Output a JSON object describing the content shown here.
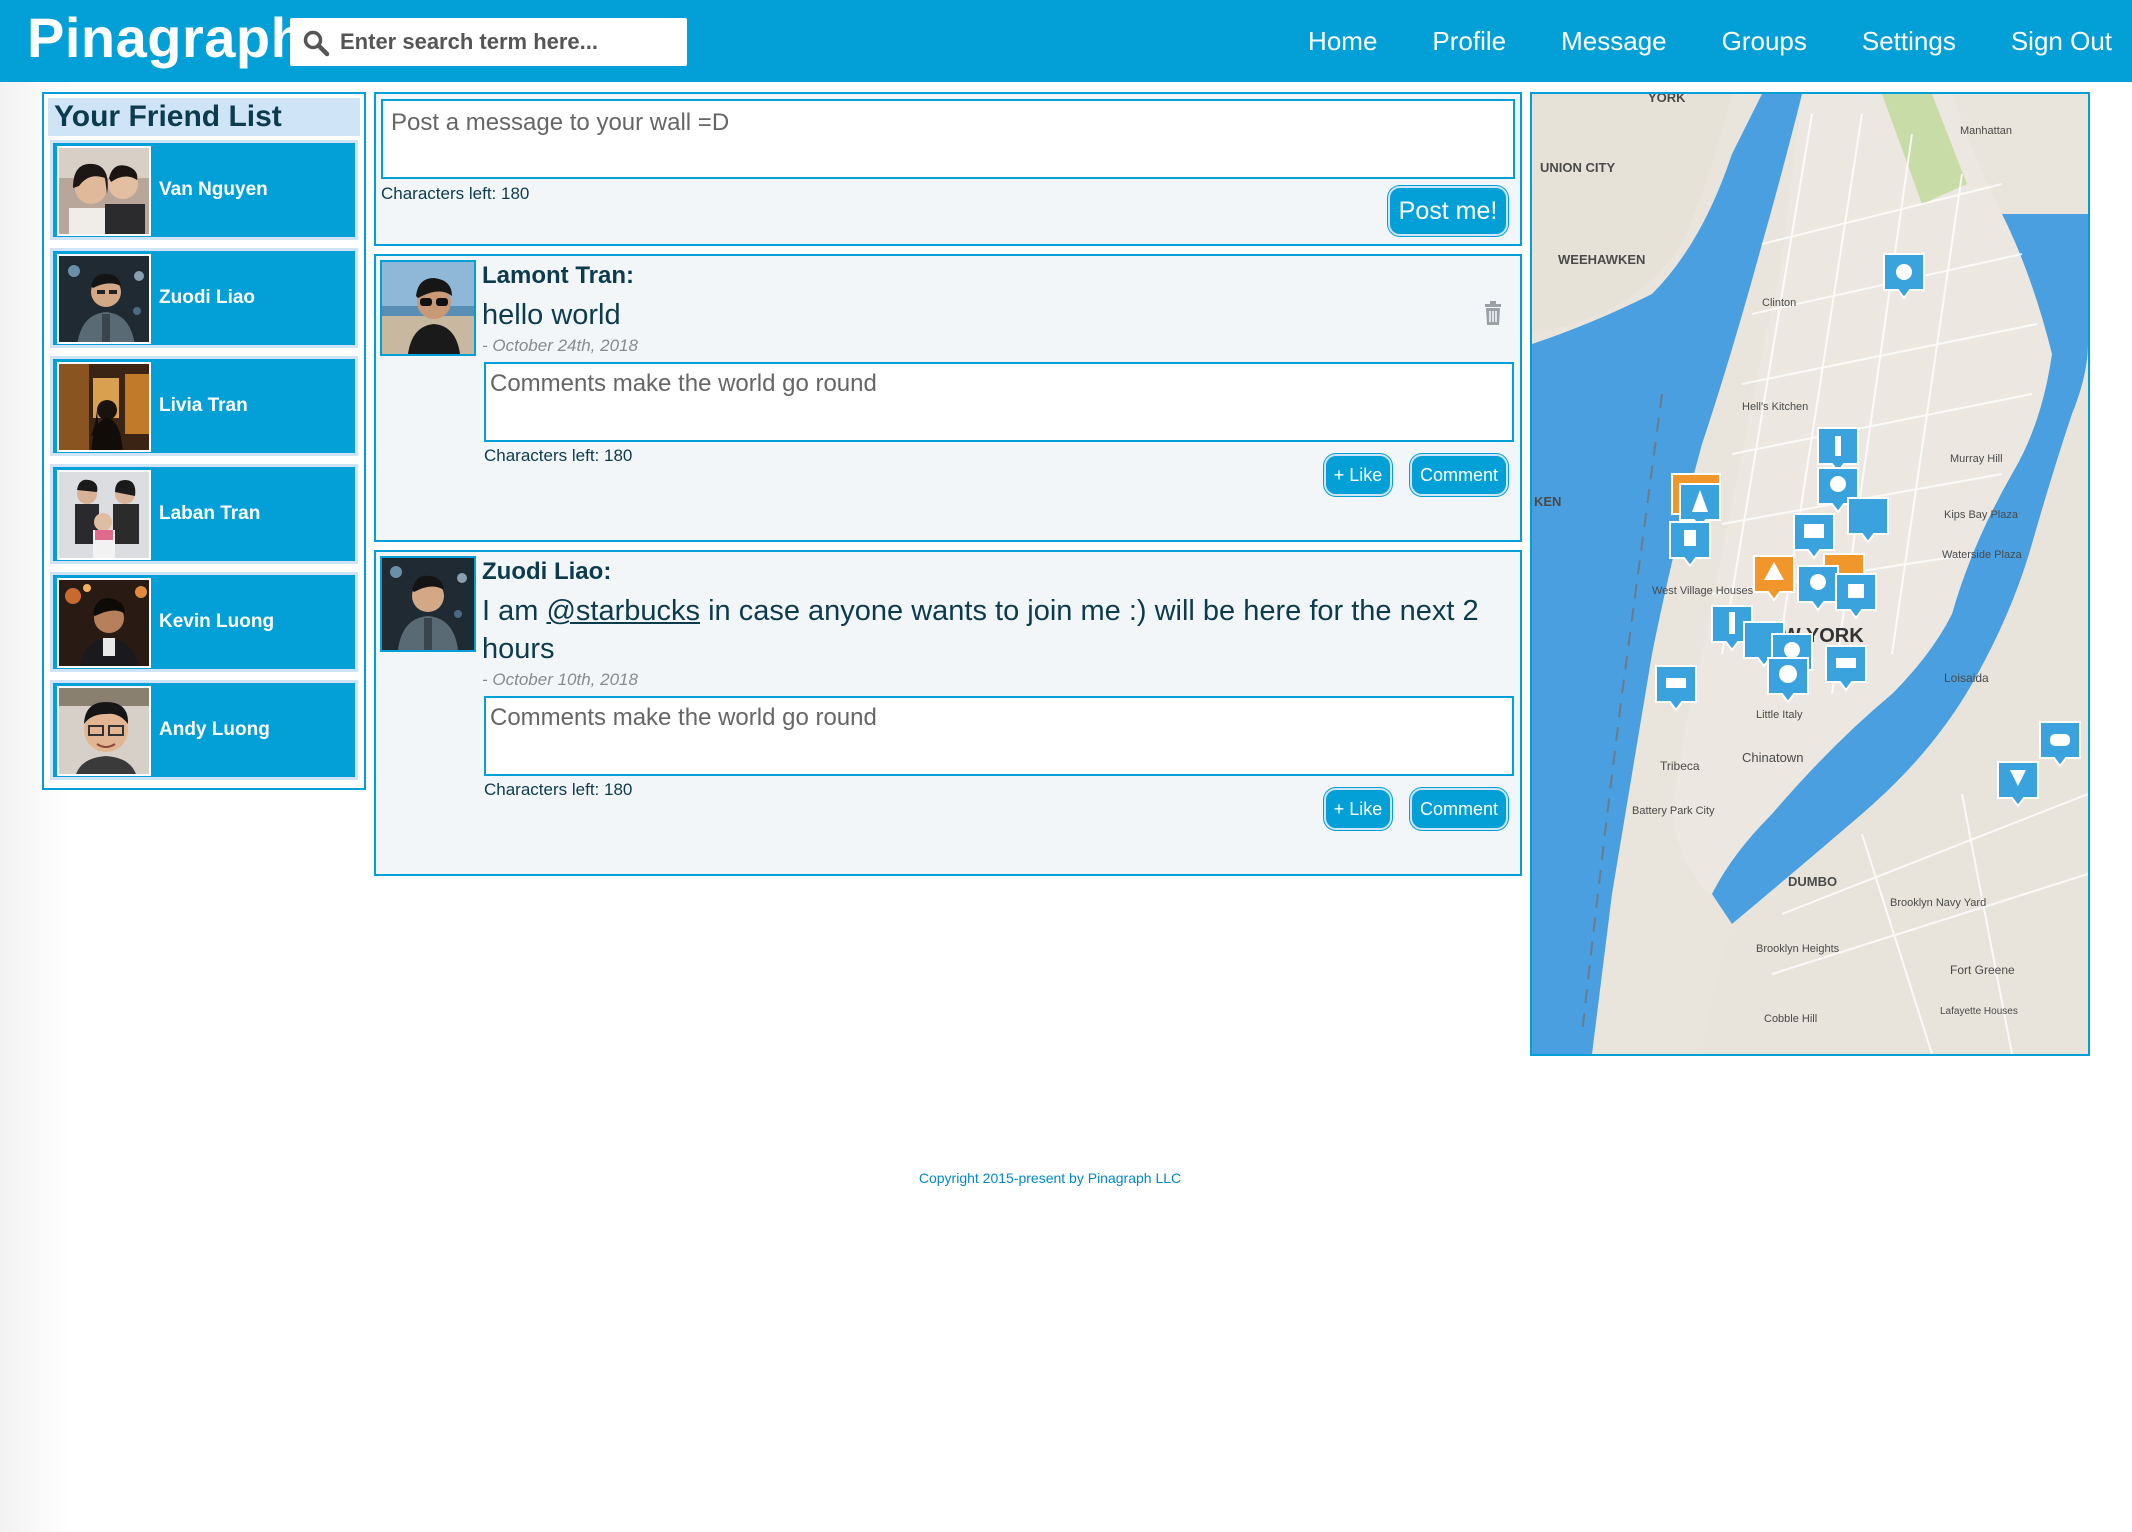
{
  "app": {
    "brand": "Pinagraph"
  },
  "search": {
    "placeholder": "Enter search term here..."
  },
  "nav": {
    "home": "Home",
    "profile": "Profile",
    "message": "Message",
    "groups": "Groups",
    "settings": "Settings",
    "signout": "Sign Out"
  },
  "friends": {
    "title": "Your Friend List",
    "items": [
      {
        "name": "Van Nguyen"
      },
      {
        "name": "Zuodi Liao"
      },
      {
        "name": "Livia Tran"
      },
      {
        "name": "Laban Tran"
      },
      {
        "name": "Kevin Luong"
      },
      {
        "name": "Andy Luong"
      }
    ]
  },
  "composer": {
    "placeholder": "Post a message to your wall =D",
    "chars_left": "Characters left: 180",
    "post_label": "Post me!"
  },
  "posts": [
    {
      "author": "Lamont Tran:",
      "text": "hello world",
      "date": "- October 24th, 2018",
      "comment_placeholder": "Comments make the world go round",
      "chars_left": "Characters left: 180",
      "like_label": "+ Like",
      "comment_label": "Comment"
    },
    {
      "author": "Zuodi Liao:",
      "text_before": "I am ",
      "mention": "@starbucks",
      "text_after": " in case anyone wants to join me :) will be here for the next 2 hours",
      "date": "- October 10th, 2018",
      "comment_placeholder": "Comments make the world go round",
      "chars_left": "Characters left: 180",
      "like_label": "+ Like",
      "comment_label": "Comment"
    }
  ],
  "map": {
    "labels": {
      "york": "YORK",
      "union_city": "UNION CITY",
      "weehawken": "WEEHAWKEN",
      "manhattan": "Manhattan",
      "york_side": "NEW YORK",
      "ken": "KEN",
      "chinatown": "Chinatown",
      "little_italy": "Little Italy",
      "tribeca": "Tribeca",
      "dumbo": "DUMBO",
      "brooklyn_heights": "Brooklyn Heights",
      "fort_greene": "Fort Greene",
      "loisaida": "Loisaida",
      "kips_bay": "Kips Bay Plaza",
      "murray_hill": "Murray Hill",
      "hells_kitchen": "Hell's Kitchen",
      "clinton": "Clinton",
      "waterside": "Waterside Plaza",
      "battery": "Battery Park City",
      "cobble_hill": "Cobble Hill",
      "navy_yard": "Brooklyn Navy Yard",
      "west_village": "West Village Houses",
      "lafayette": "Lafayette Houses"
    },
    "colors": {
      "water": "#4a9fe0",
      "land": "#e9e5dd",
      "pin": "#3aa2dc",
      "pin_alt": "#f0962a"
    }
  },
  "footer": {
    "copyright": "Copyright 2015-present by Pinagraph LLC"
  }
}
